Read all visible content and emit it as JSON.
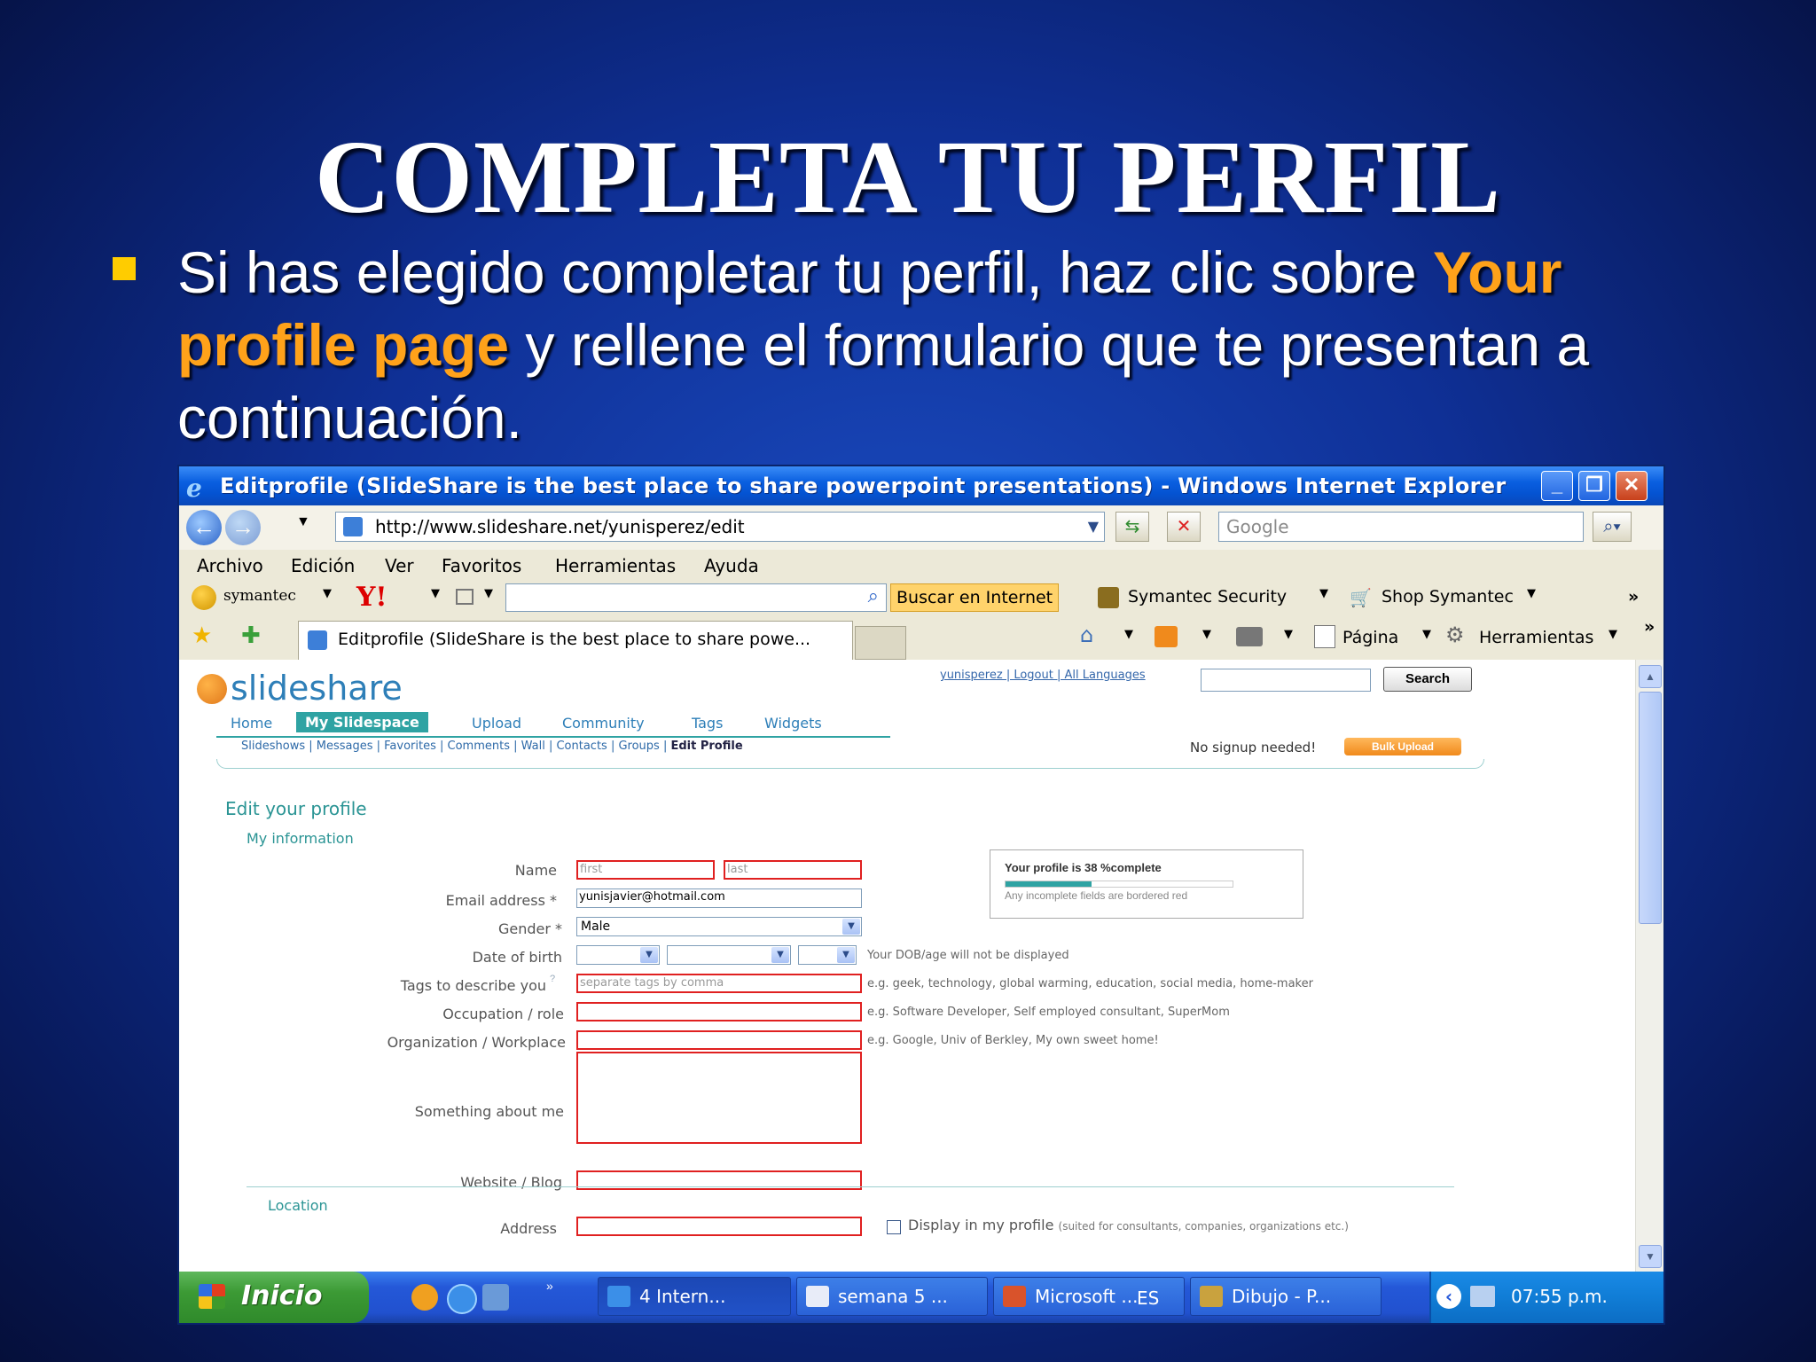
{
  "slide": {
    "title": "COMPLETA TU PERFIL",
    "bullet_part1": "Si has elegido completar tu perfil, haz clic sobre ",
    "bullet_highlight": "Your profile page",
    "bullet_part2": " y rellene el formulario que te presentan a continuación."
  },
  "window": {
    "title": "Editprofile (SlideShare is the best place to share powerpoint presentations) - Windows Internet Explorer",
    "url": "http://www.slideshare.net/yunisperez/edit",
    "search_placeholder": "Google",
    "menu": [
      "Archivo",
      "Edición",
      "Ver",
      "Favoritos",
      "Herramientas",
      "Ayuda"
    ],
    "toolbar": {
      "symantec": "symantec",
      "buscar": "Buscar en Internet",
      "security": "Symantec Security",
      "shop": "Shop Symantec"
    },
    "tab_title": "Editprofile (SlideShare is the best place to share powe...",
    "page_menu": "Página",
    "tools_menu": "Herramientas"
  },
  "site": {
    "logo": "slideshare",
    "top_links": "yunisperez | Logout | All Languages",
    "search_button": "Search",
    "nav": [
      "Home",
      "My Slidespace",
      "Upload",
      "Community",
      "Tags",
      "Widgets"
    ],
    "subnav": "Slideshows | Messages | Favorites | Comments | Wall | Contacts | Groups | ",
    "subnav_active": "Edit Profile",
    "no_signup": "No signup needed!",
    "bulk_upload": "Bulk Upload"
  },
  "form": {
    "heading": "Edit your profile",
    "section": "My information",
    "labels": {
      "name": "Name",
      "email": "Email address *",
      "gender": "Gender *",
      "dob": "Date of birth",
      "tags": "Tags to describe you",
      "occupation": "Occupation / role",
      "organization": "Organization / Workplace",
      "about": "Something about me",
      "website": "Website / Blog",
      "address": "Address"
    },
    "first_placeholder": "first",
    "last_placeholder": "last",
    "email_value": "yunisjavier@hotmail.com",
    "gender_value": "Male",
    "tags_placeholder": "separate tags by comma",
    "dob_hint": "Your DOB/age will not be displayed",
    "tags_hint": "e.g. geek, technology, global warming, education, social media, home-maker",
    "occupation_hint": "e.g. Software Developer, Self employed consultant, SuperMom",
    "organization_hint": "e.g. Google, Univ of Berkley, My own sweet home!",
    "profile_status": "Your profile is 38 %complete",
    "profile_percent": 38,
    "profile_note": "Any incomplete fields are bordered red",
    "location_heading": "Location",
    "display_label": "Display in my profile",
    "display_note": "(suited for consultants, companies, organizations etc.)"
  },
  "taskbar": {
    "start": "Inicio",
    "items": [
      "4 Intern...",
      "semana 5 ...",
      "Microsoft ...",
      "Dibujo - P..."
    ],
    "lang": "ES",
    "clock": "07:55 p.m."
  }
}
